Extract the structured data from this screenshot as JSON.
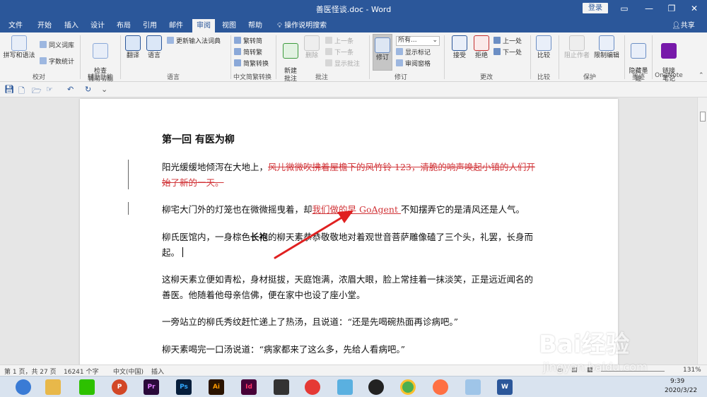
{
  "window": {
    "title": "善医怪谈.doc - Word",
    "login_label": "登录",
    "controls": [
      "▭",
      "—",
      "❐",
      "✕"
    ]
  },
  "tabs": [
    "文件",
    "开始",
    "插入",
    "设计",
    "布局",
    "引用",
    "邮件",
    "审阅",
    "视图",
    "帮助"
  ],
  "active_tab": "审阅",
  "tell_me": "操作说明搜索",
  "share_label": "共享",
  "ribbon": {
    "proofing": {
      "spelling": "拼写和语法",
      "thesaurus": "同义词库",
      "wordcount": "字数统计",
      "label": "校对"
    },
    "accessibility": {
      "check": "检查\n辅助功能",
      "label": "辅助功能"
    },
    "language": {
      "translate": "翻译",
      "language": "语言",
      "update_ime": "更新输入法词典",
      "label": "语言"
    },
    "chinese_conversion": {
      "to_simplified": "繁转简",
      "to_traditional": "简转繁",
      "convert": "简繁转换",
      "label": "中文简繁转换"
    },
    "comments": {
      "new": "新建\n批注",
      "delete": "删除",
      "prev": "上一条",
      "next": "下一条",
      "show": "显示批注",
      "label": "批注"
    },
    "tracking": {
      "track": "修订",
      "markup_select": "所有...",
      "show_markup": "显示标记",
      "reviewing_pane": "审阅窗格",
      "label": "修订"
    },
    "changes": {
      "accept": "接受",
      "reject": "拒绝",
      "prev": "上一处",
      "next": "下一处",
      "label": "更改"
    },
    "compare": {
      "compare": "比较",
      "label": "比较"
    },
    "protect": {
      "block_authors": "阻止作者",
      "restrict": "限制编辑",
      "label": "保护"
    },
    "ink": {
      "hide_ink": "隐藏墨\n迹",
      "label": "墨迹"
    },
    "onenote": {
      "linked_notes": "链接\n笔记",
      "label": "OneNote"
    }
  },
  "document": {
    "heading": "第一回  有医为柳",
    "p1_normal": "阳光缓缓地倾泻在大地上，",
    "p1_deleted": "风儿微微吹拂着屋檐下的风竹铃 123，清脆的响声唤起小镇的人们开始了新的一天。",
    "p2_before": "柳宅大门外的灯笼也在微微摇曳着，却",
    "p2_inserted": "我们做的早 GoAgent ",
    "p2_after": "不知摆弄它的是清风还是人气。",
    "p3_a": "柳氏医馆内，一身棕色",
    "p3_bold": "长袍",
    "p3_b": "的柳天素恭恭敬敬地对着观世音菩萨雕像磕了三个头，礼罢，长身而起。",
    "p4": "这柳天素立便如青松，身材挺拔，天庭饱满，浓眉大眼，脸上常挂着一抹淡笑，正是远近闻名的善医。他随着他母亲信佛，便在家中也设了座小堂。",
    "p5": "一旁站立的柳氏秀纹赶忙递上了热汤，且说道：“还是先喝碗热面再诊病吧。”",
    "p6": "柳天素喝完一口汤说道：“病家都来了这么多，先给人看病吧。”"
  },
  "status": {
    "page": "第 1 页，共 27 页",
    "words": "16241 个字",
    "language": "中文(中国)",
    "mode": "插入",
    "zoom": "131%"
  },
  "taskbar": {
    "apps": [
      "IE",
      "文件夹",
      "微信",
      "PowerPoint",
      "Premiere",
      "Photoshop",
      "Illustrator",
      "InDesign",
      "视频",
      "图片",
      "工具",
      "QQ",
      "Chrome",
      "应用",
      "笔记",
      "Word"
    ],
    "time": "9:39",
    "date": "2020/3/22"
  },
  "watermark": {
    "brand": "Bai经验",
    "url": "jingyan.baidu.com"
  },
  "colors": {
    "word_blue": "#2b579a",
    "revision_red": "#d13438",
    "annotation_arrow": "#e02020"
  }
}
